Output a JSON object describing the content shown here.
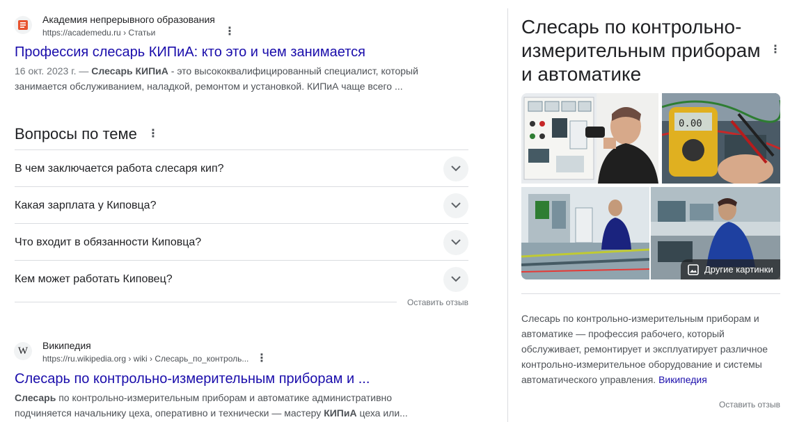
{
  "result1": {
    "site_name": "Академия непрерывного образования",
    "url_host": "https://academedu.ru",
    "url_path": " › Статьи",
    "title": "Профессия слесарь КИПиА: кто это и чем занимается",
    "date": "16 окт. 2023 г. —",
    "snippet_bold": "Слесарь КИПиА",
    "snippet_line1_rest": " - это высококвалифицированный специалист, который",
    "snippet_line2": "занимается обслуживанием, наладкой, ремонтом и установкой. КИПиА чаще всего ..."
  },
  "paa": {
    "title": "Вопросы по теме",
    "questions": [
      "В чем заключается работа слесаря кип?",
      "Какая зарплата у Киповца?",
      "Что входит в обязанности Киповца?",
      "Кем может работать Киповец?"
    ],
    "feedback": "Оставить отзыв"
  },
  "result2": {
    "site_name": "Википедия",
    "url_host": "https://ru.wikipedia.org",
    "url_path": " › wiki › Слесарь_по_контроль...",
    "title": "Слесарь по контрольно-измерительным приборам и ...",
    "line1_bold": "Слесарь",
    "line1_rest": " по контрольно-измерительным приборам и автоматике административно",
    "line2_start": "подчиняется начальнику цеха, оперативно и технически — мастеру ",
    "line2_bold": "КИПиА",
    "line2_end": " цеха или..."
  },
  "knowledge_panel": {
    "title": "Слесарь по контрольно-измерительным приборам и автоматике",
    "more_images": "Другие картинки",
    "description": "Слесарь по контрольно-измерительным приборам и автоматике — профессия рабочего, который обслуживает, ремонтирует и эксплуатирует различное контрольно-измерительное оборудование и системы автоматического управления. ",
    "source": "Википедия",
    "feedback": "Оставить отзыв"
  },
  "colors": {
    "link": "#1a0dab",
    "text": "#202124",
    "muted": "#4d5156",
    "divider": "#dadce0"
  }
}
